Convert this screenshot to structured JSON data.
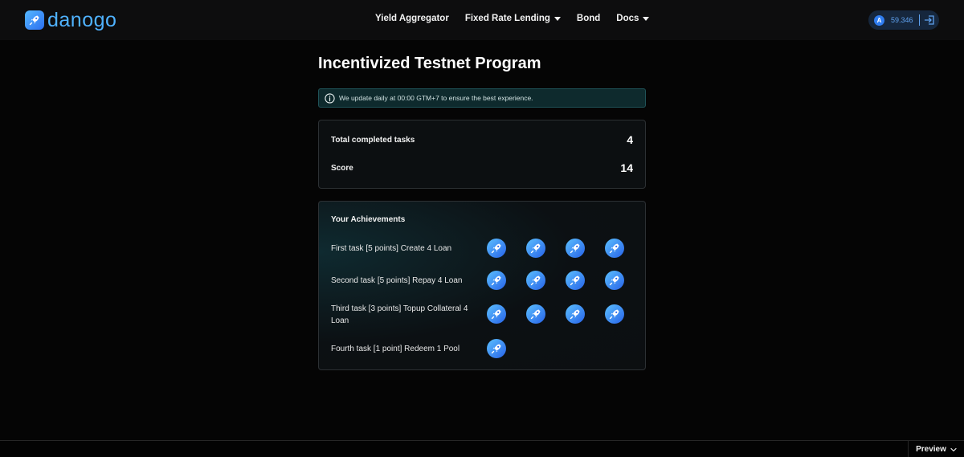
{
  "header": {
    "logo_text": "danogo",
    "nav": [
      {
        "label": "Yield Aggregator",
        "dropdown": false
      },
      {
        "label": "Fixed Rate Lending",
        "dropdown": true
      },
      {
        "label": "Bond",
        "dropdown": false
      },
      {
        "label": "Docs",
        "dropdown": true
      }
    ],
    "wallet": {
      "avatar": "A",
      "balance": "59.346"
    }
  },
  "main": {
    "title": "Incentivized Testnet Program",
    "notice": "We update daily at 00:00 GTM+7 to ensure the best experience.",
    "stats": [
      {
        "label": "Total completed tasks",
        "value": "4"
      },
      {
        "label": "Score",
        "value": "14"
      }
    ],
    "achievements": {
      "title": "Your Achievements",
      "tasks": [
        {
          "label": "First task [5 points] Create 4 Loan",
          "badges": 4
        },
        {
          "label": "Second task [5 points] Repay 4 Loan",
          "badges": 4
        },
        {
          "label": "Third task [3 points] Topup Collateral 4 Loan",
          "badges": 4
        },
        {
          "label": "Fourth task [1 point] Redeem 1 Pool",
          "badges": 1
        }
      ]
    }
  },
  "footer": {
    "preview_label": "Preview"
  },
  "colors": {
    "accent": "#4fb2ff",
    "background": "#050505",
    "card": "#0c0f11",
    "notice_bg": "#0e2a2d"
  },
  "icons": [
    "rocket-icon",
    "info-icon",
    "logout-icon",
    "chevron-down-icon"
  ]
}
